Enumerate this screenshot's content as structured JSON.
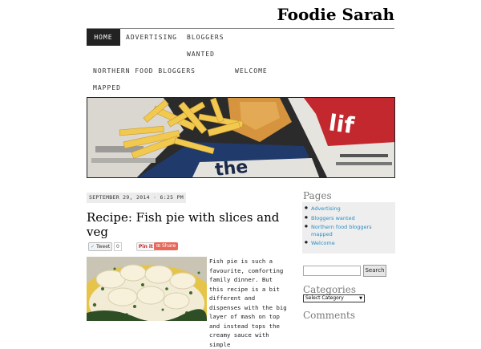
{
  "site": {
    "title": "Foodie Sarah"
  },
  "nav": {
    "items": [
      {
        "label": "HOME"
      },
      {
        "label": "ADVERTISING"
      },
      {
        "label": "BLOGGERS"
      },
      {
        "label": "WANTED"
      },
      {
        "label": "NORTHERN FOOD BLOGGERS"
      },
      {
        "label": "WELCOME"
      },
      {
        "label": "MAPPED"
      }
    ]
  },
  "post": {
    "date": "SEPTEMBER 29, 2014 · 6:25 PM",
    "title": "Recipe: Fish pie with slices and veg",
    "share": {
      "tweet": "Tweet",
      "tweet_count": "0",
      "pin": "Pin it",
      "share": "Share"
    },
    "excerpt": "Fish pie is such a favourite, comforting family dinner. But this recipe is a bit different and dispenses with the big layer of mash on top and instead tops the creamy sauce with simple"
  },
  "sidebar": {
    "pages_title": "Pages",
    "pages": [
      "Advertising",
      "Bloggers wanted",
      "Northern food bloggers mapped",
      "Welcome"
    ],
    "search_button": "Search",
    "categories_title": "Categories",
    "category_select": "Select Category",
    "comments_title": "Comments"
  },
  "colors": {
    "link": "#2a8fc4",
    "nav_active_bg": "#222222",
    "share_red": "#e8685b"
  }
}
